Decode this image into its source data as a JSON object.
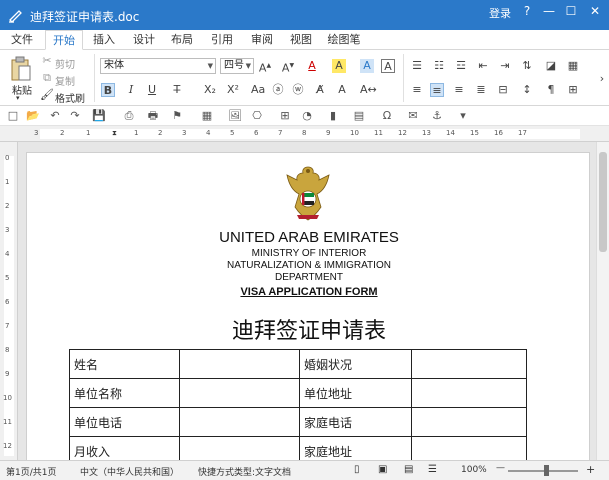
{
  "titlebar": {
    "title": "迪拜签证申请表.doc",
    "login": "登录",
    "help": "?",
    "minimize": "—",
    "maximize": "☐",
    "close": "✕"
  },
  "menu": {
    "tabs": [
      "文件",
      "开始",
      "插入",
      "设计",
      "布局",
      "引用",
      "审阅",
      "视图",
      "绘图笔"
    ],
    "active": "开始"
  },
  "ribbon": {
    "paste": "粘贴",
    "cut": "剪切",
    "copy": "复制",
    "format_painter": "格式刷",
    "font_name": "宋体",
    "font_size": "四号"
  },
  "document": {
    "heading1": "UNITED ARAB EMIRATES",
    "heading2": "MINISTRY OF INTERIOR",
    "heading3": "NATURALIZATION & IMMIGRATION",
    "heading4": "DEPARTMENT",
    "form_title_en": "VISA APPLICATION FORM",
    "form_title_cn": "迪拜签证申请表",
    "table": [
      [
        "姓名",
        "",
        "婚姻状况",
        ""
      ],
      [
        "单位名称",
        "",
        "单位地址",
        ""
      ],
      [
        "单位电话",
        "",
        "家庭电话",
        ""
      ],
      [
        "月收入",
        "",
        "家庭地址",
        ""
      ]
    ]
  },
  "ruler": {
    "h_numbers": [
      "3",
      "2",
      "1",
      "1",
      "2",
      "3",
      "4",
      "5",
      "6",
      "7",
      "8",
      "9",
      "10",
      "11",
      "12",
      "13",
      "14",
      "15",
      "16",
      "17"
    ],
    "v_numbers": [
      "0",
      "1",
      "2",
      "3",
      "4",
      "5",
      "6",
      "7",
      "8",
      "9",
      "10",
      "11",
      "12"
    ]
  },
  "statusbar": {
    "page": "第1页/共1页",
    "language": "中文（中华人民共和国）",
    "doc_type": "快捷方式类型:文字文档",
    "zoom": "100%",
    "zoom_minus": "—",
    "zoom_plus": "+"
  },
  "colors": {
    "titlebar": "#2b79c9",
    "accent": "#2b79c9"
  }
}
